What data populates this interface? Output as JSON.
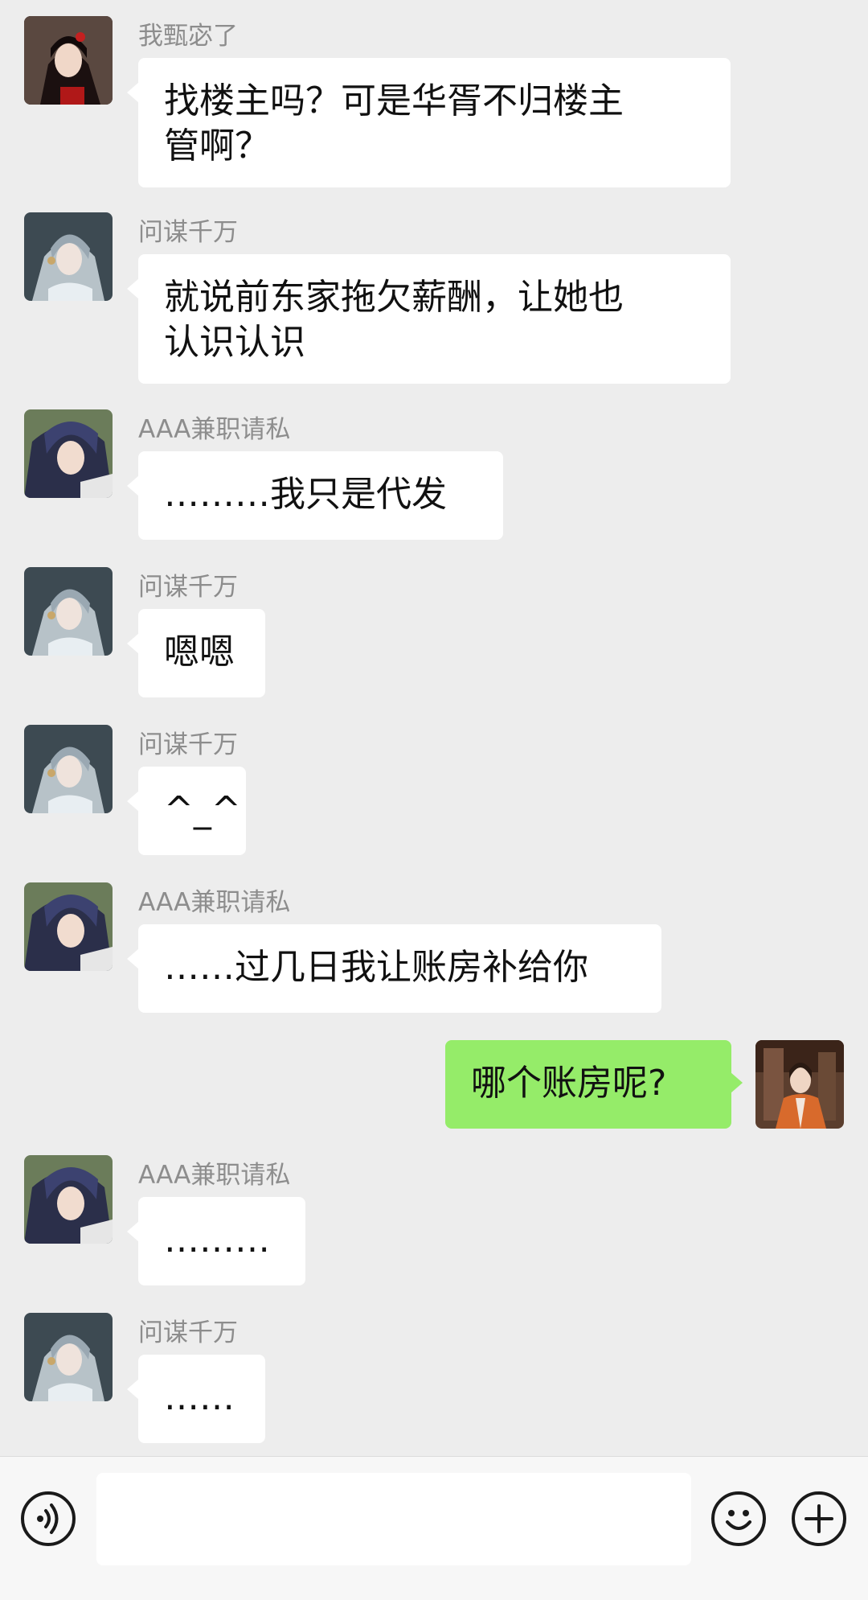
{
  "messages": [
    {
      "sender": "我甄宓了",
      "lines": [
        "找楼主吗？可是华胥不归楼主",
        "管啊？"
      ],
      "avatar": "avatar-dark-hair-girl"
    },
    {
      "sender": "问谋千万",
      "lines": [
        "就说前东家拖欠薪酬，让她也",
        "认识认识"
      ],
      "avatar": "avatar-silver-hair-man"
    },
    {
      "sender": "AAA兼职请私",
      "lines": [
        "………我只是代发"
      ],
      "avatar": "avatar-blue-hair-man"
    },
    {
      "sender": "问谋千万",
      "lines": [
        "嗯嗯"
      ],
      "avatar": "avatar-silver-hair-man"
    },
    {
      "sender": "问谋千万",
      "lines": [
        "^_^"
      ],
      "avatar": "avatar-silver-hair-man"
    },
    {
      "sender": "AAA兼职请私",
      "lines": [
        "……过几日我让账房补给你"
      ],
      "avatar": "avatar-blue-hair-man"
    },
    {
      "sender": "",
      "lines": [
        "哪个账房呢?"
      ],
      "avatar": "avatar-orange-robe-lady"
    },
    {
      "sender": "AAA兼职请私",
      "lines": [
        "………"
      ],
      "avatar": "avatar-blue-hair-man"
    },
    {
      "sender": "问谋千万",
      "lines": [
        "……"
      ],
      "avatar": "avatar-silver-hair-man"
    }
  ],
  "input": {
    "value": "",
    "placeholder": ""
  },
  "icons": {
    "voice": "voice-icon",
    "emoji": "emoji-icon",
    "plus": "plus-icon"
  },
  "colors": {
    "background": "#ededed",
    "bubble_other": "#ffffff",
    "bubble_self": "#95ec69",
    "sender_name": "#8d8d8d"
  }
}
